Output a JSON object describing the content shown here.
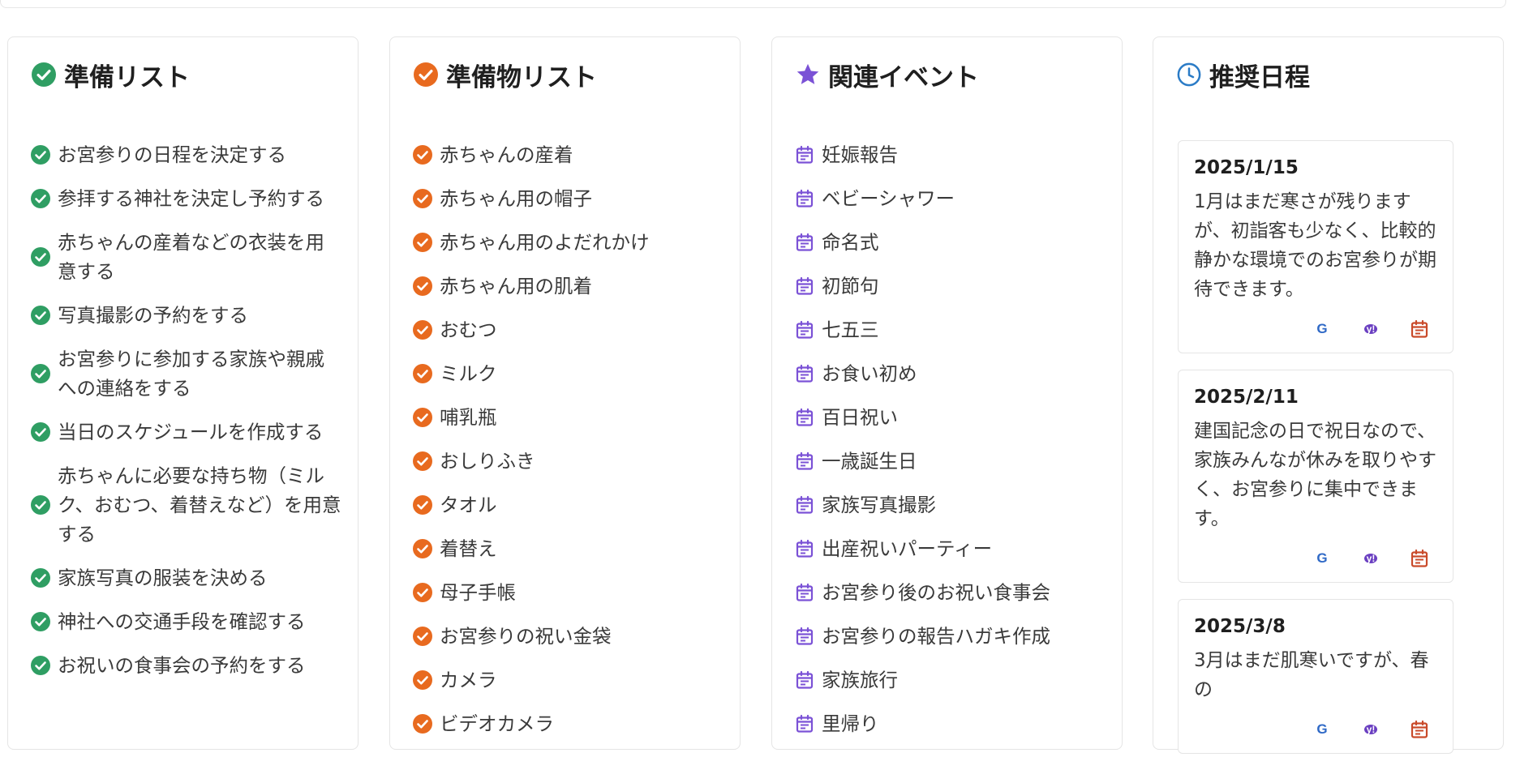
{
  "colors": {
    "green": "#2f9e63",
    "orange": "#e86a1f",
    "purple": "#7b52d6",
    "blue": "#2a7bc6",
    "calendar_red": "#c94a2a"
  },
  "prep_list": {
    "title": "準備リスト",
    "icon": "check-circle-icon",
    "items": [
      "お宮参りの日程を決定する",
      "参拝する神社を決定し予約する",
      "赤ちゃんの産着などの衣装を用意する",
      "写真撮影の予約をする",
      "お宮参りに参加する家族や親戚への連絡をする",
      "当日のスケジュールを作成する",
      "赤ちゃんに必要な持ち物（ミルク、おむつ、着替えなど）を用意する",
      "家族写真の服装を決める",
      "神社への交通手段を確認する",
      "お祝いの食事会の予約をする"
    ]
  },
  "items_list": {
    "title": "準備物リスト",
    "icon": "check-circle-icon",
    "items": [
      "赤ちゃんの産着",
      "赤ちゃん用の帽子",
      "赤ちゃん用のよだれかけ",
      "赤ちゃん用の肌着",
      "おむつ",
      "ミルク",
      "哺乳瓶",
      "おしりふき",
      "タオル",
      "着替え",
      "母子手帳",
      "お宮参りの祝い金袋",
      "カメラ",
      "ビデオカメラ"
    ]
  },
  "events": {
    "title": "関連イベント",
    "icon": "star-icon",
    "item_icon": "calendar-icon",
    "items": [
      "妊娠報告",
      "ベビーシャワー",
      "命名式",
      "初節句",
      "七五三",
      "お食い初め",
      "百日祝い",
      "一歳誕生日",
      "家族写真撮影",
      "出産祝いパーティー",
      "お宮参り後のお祝い食事会",
      "お宮参りの報告ハガキ作成",
      "家族旅行",
      "里帰り"
    ]
  },
  "schedule": {
    "title": "推奨日程",
    "icon": "clock-icon",
    "items": [
      {
        "date": "2025/1/15",
        "desc": "1月はまだ寒さが残りますが、初詣客も少なく、比較的静かな環境でのお宮参りが期待できます。",
        "actions": {
          "google": "G",
          "yahoo": "y!"
        }
      },
      {
        "date": "2025/2/11",
        "desc": "建国記念の日で祝日なので、家族みんなが休みを取りやすく、お宮参りに集中できます。",
        "actions": {
          "google": "G",
          "yahoo": "y!"
        }
      },
      {
        "date": "2025/3/8",
        "desc": "3月はまだ肌寒いですが、春の",
        "actions": {
          "google": "G",
          "yahoo": "y!"
        }
      }
    ]
  }
}
